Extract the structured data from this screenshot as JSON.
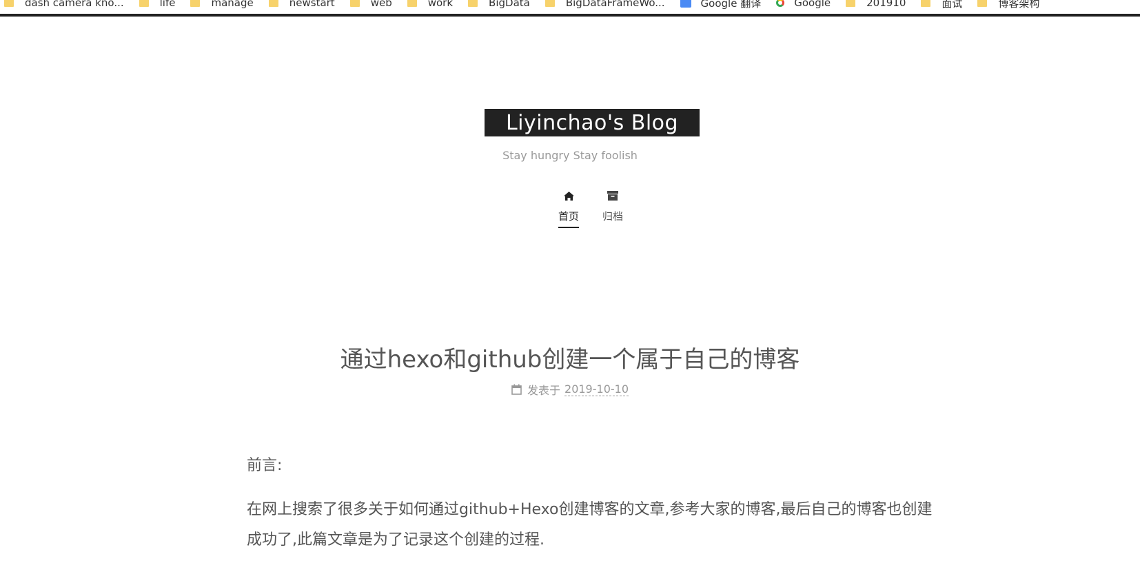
{
  "bookmarks": [
    {
      "label": "dash camera kno...",
      "icon": "folder-icon"
    },
    {
      "label": "life",
      "icon": "folder-icon"
    },
    {
      "label": "manage",
      "icon": "folder-icon"
    },
    {
      "label": "newstart",
      "icon": "folder-icon"
    },
    {
      "label": "web",
      "icon": "folder-icon"
    },
    {
      "label": "work",
      "icon": "folder-icon"
    },
    {
      "label": "BigData",
      "icon": "folder-icon"
    },
    {
      "label": "BigDataFrameWo...",
      "icon": "folder-icon"
    },
    {
      "label": "Google 翻译",
      "icon": "google-translate-icon"
    },
    {
      "label": "Google",
      "icon": "google-icon"
    },
    {
      "label": "201910",
      "icon": "folder-icon"
    },
    {
      "label": "面试",
      "icon": "folder-icon"
    },
    {
      "label": "博客架构",
      "icon": "folder-icon"
    }
  ],
  "site": {
    "title": "Liyinchao's Blog",
    "subtitle": "Stay hungry Stay foolish"
  },
  "nav": {
    "home": "首页",
    "archive": "归档"
  },
  "post": {
    "title": "通过hexo和github创建一个属于自己的博客",
    "meta_prefix": "发表于",
    "date": "2019-10-10",
    "paragraphs": [
      "前言:",
      "在网上搜索了很多关于如何通过github+Hexo创建博客的文章,参考大家的博客,最后自己的博客也创建成功了,此篇文章是为了记录这个创建的过程."
    ]
  },
  "colors": {
    "title_bg": "#222222",
    "text": "#555555",
    "muted": "#999999"
  }
}
